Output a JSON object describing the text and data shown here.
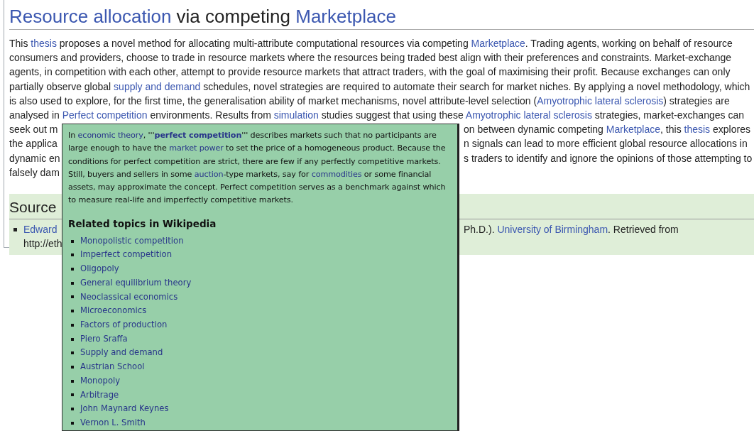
{
  "title": [
    {
      "kind": "link",
      "text": "Resource allocation"
    },
    {
      "kind": "text",
      "text": " via competing "
    },
    {
      "kind": "link",
      "text": "Marketplace"
    }
  ],
  "abstract": [
    {
      "left": [
        {
          "kind": "text",
          "text": "This "
        },
        {
          "kind": "link",
          "text": "thesis"
        },
        {
          "kind": "text",
          "text": " proposes a novel method for allocating multi-attribute computational resources via competing "
        },
        {
          "kind": "link",
          "text": "Marketplace"
        },
        {
          "kind": "text",
          "text": ". Trading agents, working on behalf of resource"
        }
      ]
    },
    {
      "left": [
        {
          "kind": "text",
          "text": "consumers and providers, choose to trade in resource markets where the resources being traded best align with their preferences and constraints. Market-exchange"
        }
      ]
    },
    {
      "left": [
        {
          "kind": "text",
          "text": "agents, in competition with each other, attempt to provide resource markets that attract traders, with the goal of maximising their profit. Because exchanges can only"
        }
      ]
    },
    {
      "left": [
        {
          "kind": "text",
          "text": "partially observe global "
        },
        {
          "kind": "link",
          "text": "supply and demand"
        },
        {
          "kind": "text",
          "text": " schedules, novel strategies are required to automate their search for market niches. By applying a novel methodology, which"
        }
      ]
    },
    {
      "left": [
        {
          "kind": "text",
          "text": "is also used to explore, for the first time, the generalisation ability of market mechanisms, novel attribute-level selection ("
        },
        {
          "kind": "link",
          "text": "Amyotrophic lateral sclerosis"
        },
        {
          "kind": "text",
          "text": ") strategies are"
        }
      ]
    },
    {
      "left": [
        {
          "kind": "text",
          "text": "analysed in "
        },
        {
          "kind": "link",
          "text": "Perfect competition"
        },
        {
          "kind": "text",
          "text": " environments. Results from "
        },
        {
          "kind": "link",
          "text": "simulation"
        },
        {
          "kind": "text",
          "text": " studies suggest that using these "
        },
        {
          "kind": "link",
          "text": "Amyotrophic lateral sclerosis"
        },
        {
          "kind": "text",
          "text": " strategies, market-exchanges can"
        }
      ]
    },
    {
      "left": [
        {
          "kind": "text",
          "text": "seek out m"
        }
      ],
      "right": [
        {
          "kind": "text",
          "text": "on between dynamic competing "
        },
        {
          "kind": "link",
          "text": "Marketplace"
        },
        {
          "kind": "text",
          "text": ", this "
        },
        {
          "kind": "link",
          "text": "thesis"
        },
        {
          "kind": "text",
          "text": " explores"
        }
      ]
    },
    {
      "left": [
        {
          "kind": "text",
          "text": "the applica"
        }
      ],
      "right": [
        {
          "kind": "text",
          "text": "n signals can lead to more efficient global resource allocations in"
        }
      ]
    },
    {
      "left": [
        {
          "kind": "text",
          "text": "dynamic en"
        }
      ],
      "right": [
        {
          "kind": "text",
          "text": "s traders to identify and ignore the opinions of those attempting to"
        }
      ]
    },
    {
      "left": [
        {
          "kind": "text",
          "text": "falsely dam"
        }
      ]
    }
  ],
  "source": {
    "heading": "Source",
    "lines": [
      {
        "bullet": true,
        "left": [
          {
            "kind": "link",
            "text": "Edward"
          }
        ],
        "right": [
          {
            "kind": "text",
            "text": "Ph.D.). "
          },
          {
            "kind": "link",
            "text": "University of Birmingham"
          },
          {
            "kind": "text",
            "text": ". Retrieved from"
          }
        ]
      },
      {
        "bullet": false,
        "left": [
          {
            "kind": "text",
            "text": "http://eth"
          }
        ]
      }
    ]
  },
  "popup": {
    "paragraph": [
      {
        "kind": "text",
        "text": "In "
      },
      {
        "kind": "link",
        "text": "economic theory"
      },
      {
        "kind": "text",
        "text": ", '''"
      },
      {
        "kind": "bold_link",
        "text": "perfect competition"
      },
      {
        "kind": "text",
        "text": "''' describes markets such that no participants are large enough to have the "
      },
      {
        "kind": "link",
        "text": "market power"
      },
      {
        "kind": "text",
        "text": " to set the price of a homogeneous product. Because the conditions for perfect competition are strict, there are few if any perfectly competitive markets. Still, buyers and sellers in some "
      },
      {
        "kind": "link",
        "text": "auction"
      },
      {
        "kind": "text",
        "text": "-type markets, say for "
      },
      {
        "kind": "link",
        "text": "commodities"
      },
      {
        "kind": "text",
        "text": " or some financial assets, may approximate the concept. Perfect competition serves as a benchmark against which to measure real-life and imperfectly competitive markets."
      }
    ],
    "heading": "Related topics in Wikipedia",
    "related_topics": [
      "Monopolistic competition",
      "Imperfect competition",
      "Oligopoly",
      "General equilibrium theory",
      "Neoclassical economics",
      "Microeconomics",
      "Factors of production",
      "Piero Sraffa",
      "Supply and demand",
      "Austrian School",
      "Monopoly",
      "Arbitrage",
      "John Maynard Keynes",
      "Vernon L. Smith"
    ]
  }
}
